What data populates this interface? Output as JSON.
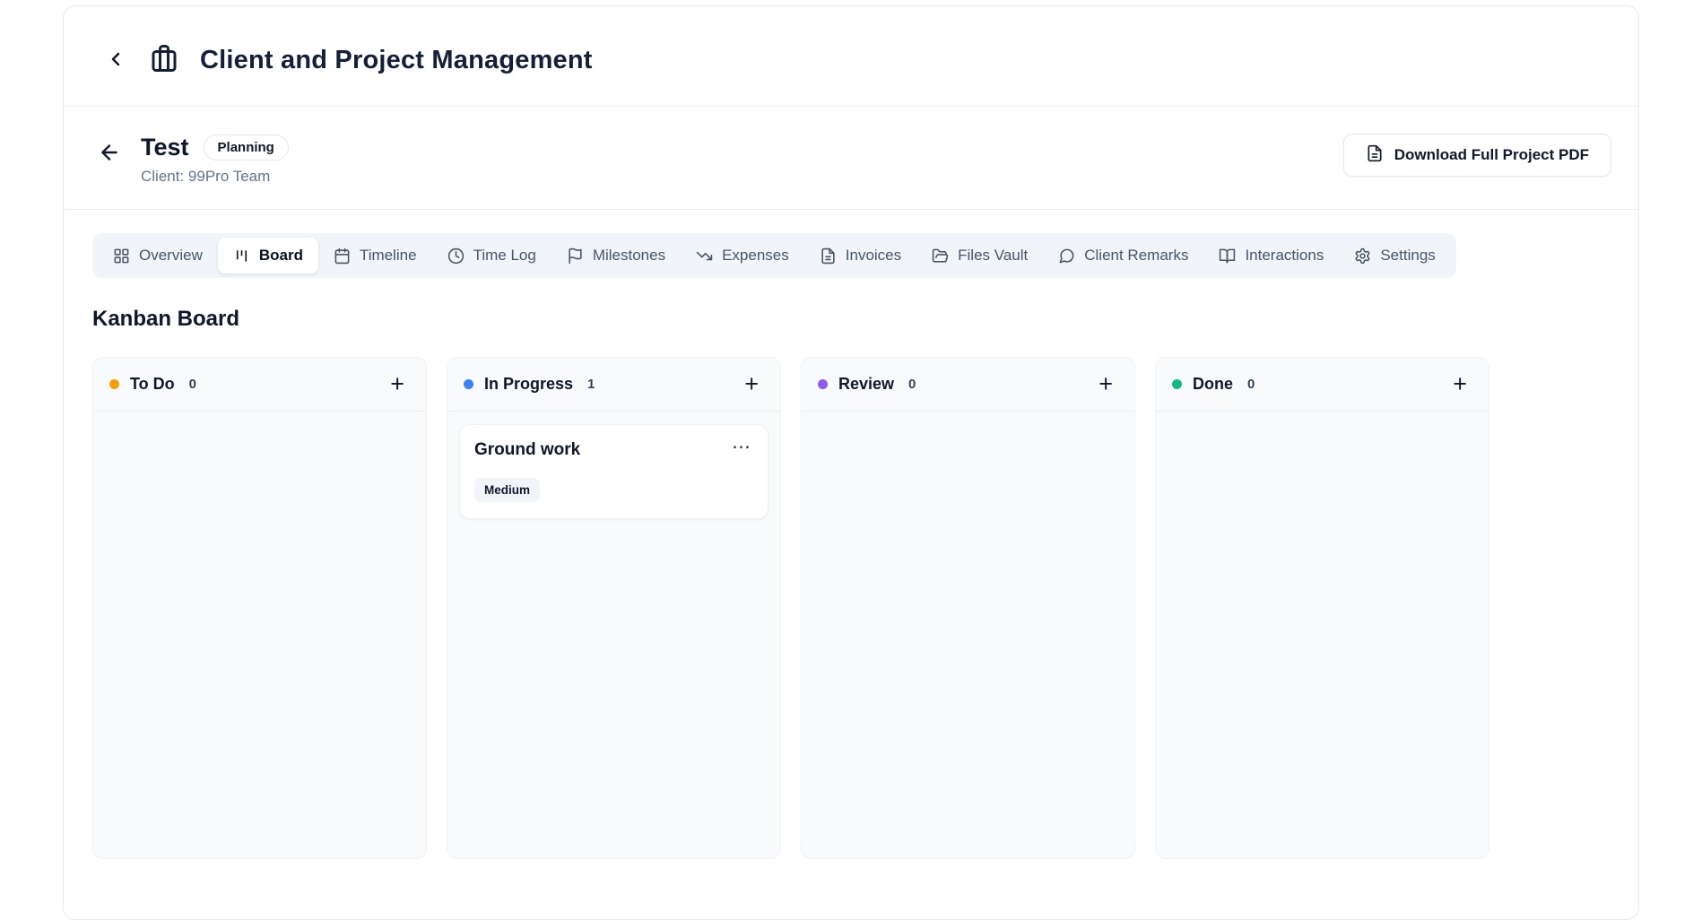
{
  "app": {
    "title": "Client and Project Management"
  },
  "project": {
    "name": "Test",
    "status_badge": "Planning",
    "client_label": "Client: 99Pro Team",
    "download_button_label": "Download Full Project PDF"
  },
  "tabs": [
    {
      "label": "Overview",
      "icon": "layout-grid-icon",
      "active": false
    },
    {
      "label": "Board",
      "icon": "kanban-icon",
      "active": true
    },
    {
      "label": "Timeline",
      "icon": "calendar-icon",
      "active": false
    },
    {
      "label": "Time Log",
      "icon": "clock-icon",
      "active": false
    },
    {
      "label": "Milestones",
      "icon": "flag-icon",
      "active": false
    },
    {
      "label": "Expenses",
      "icon": "trending-down-icon",
      "active": false
    },
    {
      "label": "Invoices",
      "icon": "file-text-icon",
      "active": false
    },
    {
      "label": "Files Vault",
      "icon": "folder-open-icon",
      "active": false
    },
    {
      "label": "Client Remarks",
      "icon": "message-circle-icon",
      "active": false
    },
    {
      "label": "Interactions",
      "icon": "book-open-icon",
      "active": false
    },
    {
      "label": "Settings",
      "icon": "gear-icon",
      "active": false
    }
  ],
  "board": {
    "heading": "Kanban Board",
    "add_button_label": "+",
    "columns": [
      {
        "name": "To Do",
        "count": "0",
        "dot_color": "#f59e0b",
        "cards": []
      },
      {
        "name": "In Progress",
        "count": "1",
        "dot_color": "#3b82f6",
        "cards": [
          {
            "title": "Ground work",
            "priority_badge": "Medium",
            "menu_glyph": "⋯"
          }
        ]
      },
      {
        "name": "Review",
        "count": "0",
        "dot_color": "#8b5cf6",
        "cards": []
      },
      {
        "name": "Done",
        "count": "0",
        "dot_color": "#10b981",
        "cards": []
      }
    ]
  }
}
